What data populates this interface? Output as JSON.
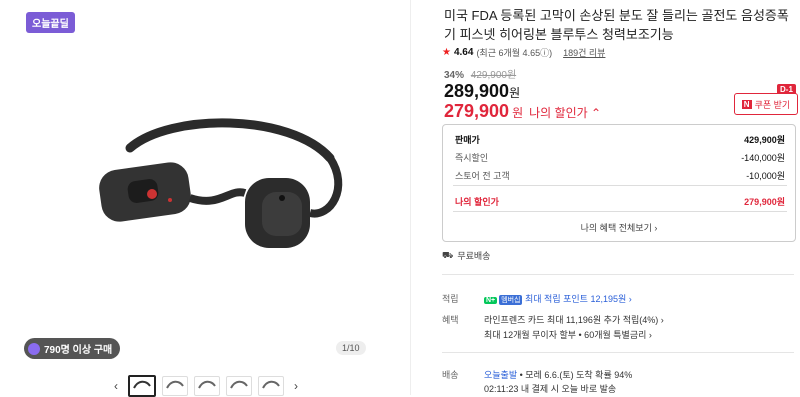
{
  "gallery": {
    "badge": "오늘끝딜",
    "buyers": "790명 이상 구매",
    "pager": "1/10",
    "prev_arrow": "‹",
    "next_arrow": "›"
  },
  "product": {
    "title": "미국 FDA 등록된 고막이 손상된 분도 잘 들리는 골전도 음성증폭기 피스넷 히어링본 블루투스 청력보조기능",
    "rating": "4.64",
    "rating_detail": "(최근 6개월 4.65ⓘ)",
    "reviews": "189건 리뷰",
    "discount_pct": "34%",
    "original_price": "429,900원",
    "price": "289,900",
    "price_unit": "원",
    "my_price": "279,900",
    "my_price_unit": "원",
    "my_price_label": "나의 할인가 ⌃",
    "coupon_label": "쿠폰 받기",
    "coupon_n": "N",
    "coupon_dday": "D-1"
  },
  "breakdown": {
    "rows": [
      {
        "k": "판매가",
        "v": "429,900원"
      },
      {
        "k": "즉시할인",
        "v": "-140,000원"
      },
      {
        "k": "스토어 전 고객",
        "v": "-10,000원"
      },
      {
        "k": "나의 할인가",
        "v": "279,900원"
      }
    ],
    "all_benefits": "나의 혜택 전체보기 ›"
  },
  "shipping_free": "무료배송",
  "points": {
    "label": "적립",
    "npay": "N+",
    "npay2": "멤버십",
    "text": "최대 적립 포인트 12,195원 ›"
  },
  "benefit": {
    "label": "혜택",
    "line1": "라인프렌즈 카드 최대 11,196원 추가 적립(4%) ›",
    "line2": "최대 12개월 무이자 할부 • 60개월 특별금리 ›"
  },
  "delivery": {
    "label": "배송",
    "line1_a": "오늘출발",
    "line1_b": " • 모레 6.6.(토) 도착 확률 94%",
    "line2": "02:11:23  내 결제 시 오늘 바로 발송"
  },
  "colors": {
    "accent": "#e0263b",
    "badge": "#7b5cd6",
    "link": "#2a5fd8"
  }
}
